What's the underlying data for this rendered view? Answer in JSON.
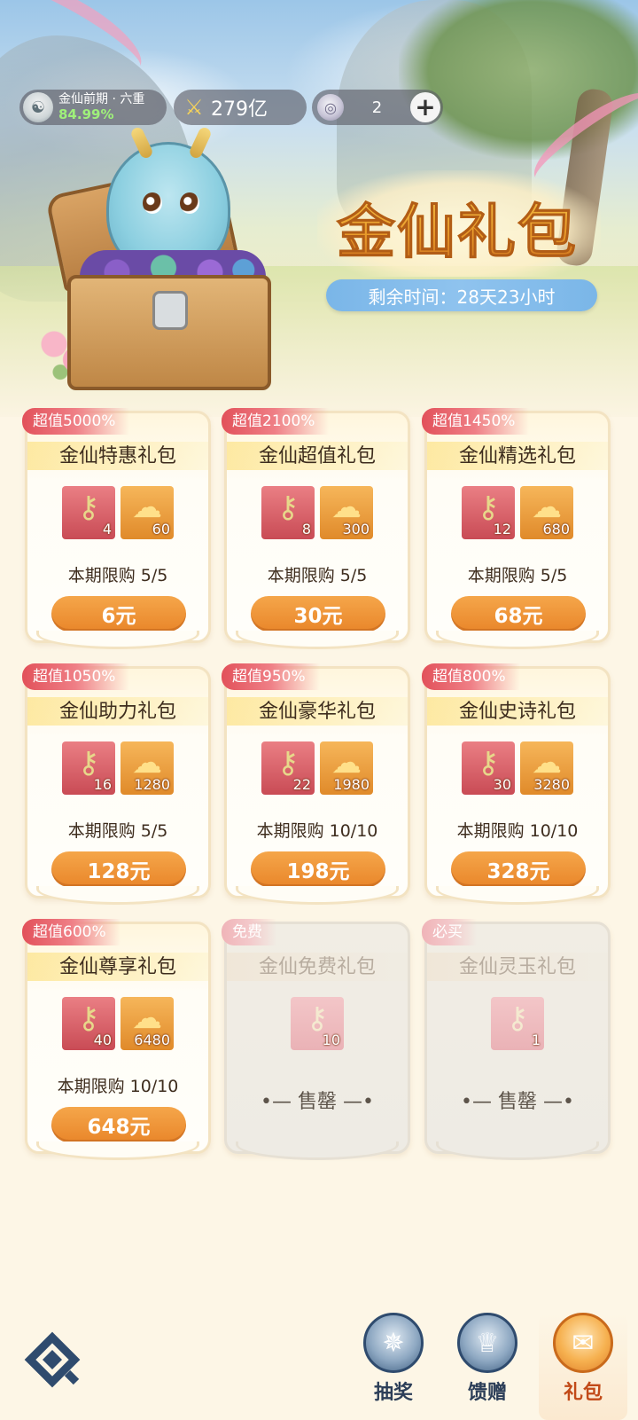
{
  "status": {
    "rank_name": "金仙前期 · 六重",
    "rank_progress": "84.99%",
    "power": "279亿",
    "currency_amount": "2",
    "add_label": "+"
  },
  "banner": {
    "title": "金仙礼包",
    "timer": "剩余时间：28天23小时"
  },
  "packs": [
    {
      "badge": "超值5000%",
      "name": "金仙特惠礼包",
      "key_qty": "4",
      "jade_qty": "60",
      "limit": "本期限购 5/5",
      "price": "6元"
    },
    {
      "badge": "超值2100%",
      "name": "金仙超值礼包",
      "key_qty": "8",
      "jade_qty": "300",
      "limit": "本期限购 5/5",
      "price": "30元"
    },
    {
      "badge": "超值1450%",
      "name": "金仙精选礼包",
      "key_qty": "12",
      "jade_qty": "680",
      "limit": "本期限购 5/5",
      "price": "68元"
    },
    {
      "badge": "超值1050%",
      "name": "金仙助力礼包",
      "key_qty": "16",
      "jade_qty": "1280",
      "limit": "本期限购 5/5",
      "price": "128元"
    },
    {
      "badge": "超值950%",
      "name": "金仙豪华礼包",
      "key_qty": "22",
      "jade_qty": "1980",
      "limit": "本期限购 10/10",
      "price": "198元"
    },
    {
      "badge": "超值800%",
      "name": "金仙史诗礼包",
      "key_qty": "30",
      "jade_qty": "3280",
      "limit": "本期限购 10/10",
      "price": "328元"
    },
    {
      "badge": "超值600%",
      "name": "金仙尊享礼包",
      "key_qty": "40",
      "jade_qty": "6480",
      "limit": "本期限购 10/10",
      "price": "648元"
    },
    {
      "badge": "免费",
      "name": "金仙免费礼包",
      "key_qty": "10",
      "soldout": "售罄"
    },
    {
      "badge": "必买",
      "name": "金仙灵玉礼包",
      "key_qty": "1",
      "soldout": "售罄"
    }
  ],
  "nav": {
    "tabs": [
      {
        "label": "抽奖",
        "icon": "wheel-icon"
      },
      {
        "label": "馈赠",
        "icon": "gift-bowl-icon"
      },
      {
        "label": "礼包",
        "icon": "gift-pack-icon",
        "active": true
      }
    ]
  },
  "colors": {
    "accent_orange": "#e9862a",
    "badge_red": "#e2515a",
    "progress_green": "#9ff07a",
    "nav_blue": "#2f4b6e"
  }
}
